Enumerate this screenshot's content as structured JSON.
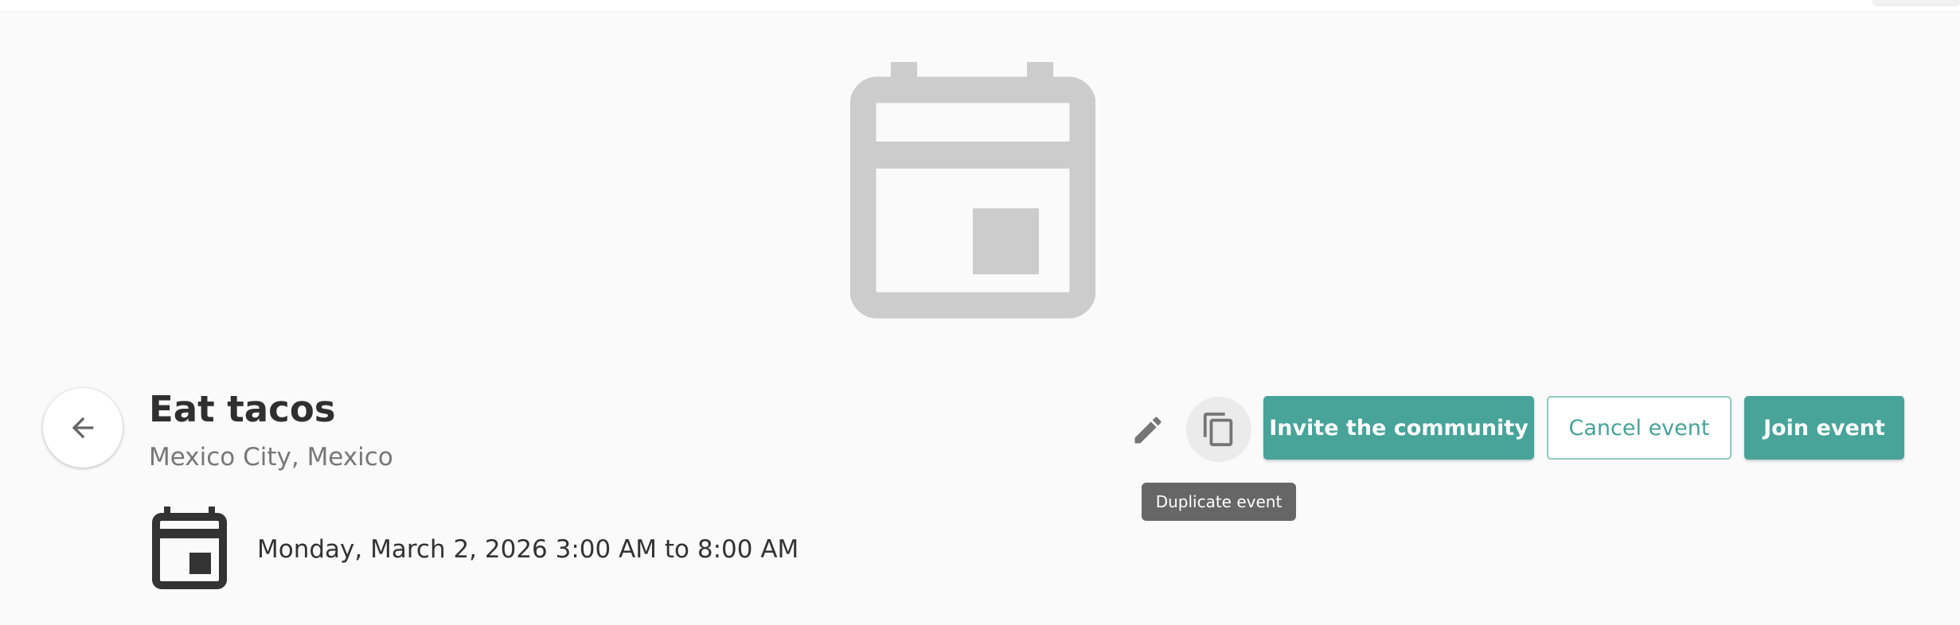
{
  "event": {
    "title": "Eat tacos",
    "location": "Mexico City, Mexico",
    "date_range": "Monday, March 2, 2026 3:00 AM to 8:00 AM"
  },
  "icons": {
    "hero": "calendar-icon",
    "back": "arrow-left-icon",
    "date": "calendar-icon",
    "edit": "pencil-icon",
    "duplicate": "copy-icon"
  },
  "actions": {
    "duplicate_tooltip": "Duplicate event",
    "invite_label": "Invite the community",
    "cancel_label": "Cancel event",
    "join_label": "Join event"
  },
  "colors": {
    "accent": "#48a399",
    "hero_icon": "#cccccc",
    "date_icon": "#333333",
    "tooltip_bg": "#666666"
  }
}
